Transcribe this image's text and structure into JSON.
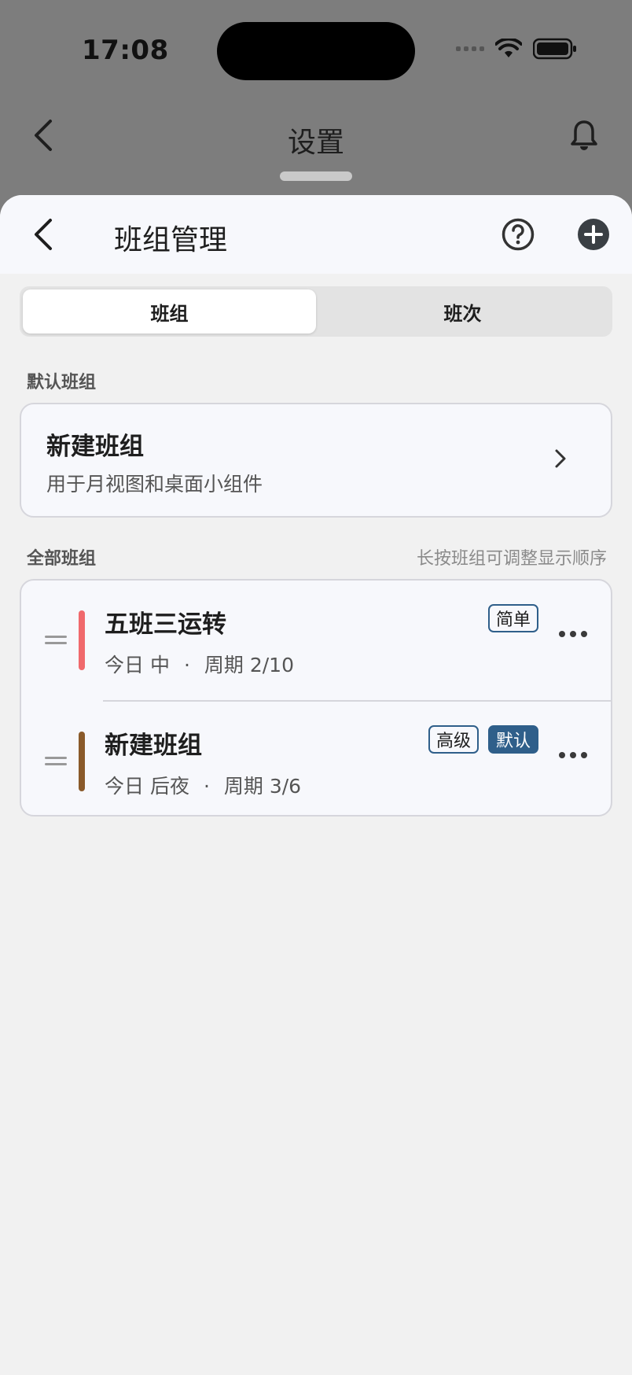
{
  "status_bar": {
    "time": "17:08"
  },
  "background_nav": {
    "title": "设置"
  },
  "sheet_nav": {
    "title": "班组管理"
  },
  "tabs": [
    {
      "label": "班组",
      "active": true
    },
    {
      "label": "班次",
      "active": false
    }
  ],
  "default_section": {
    "label": "默认班组",
    "card": {
      "title": "新建班组",
      "subtitle": "用于月视图和桌面小组件"
    }
  },
  "all_section": {
    "label": "全部班组",
    "hint": "长按班组可调整显示顺序",
    "items": [
      {
        "title": "五班三运转",
        "today": "今日 中",
        "separator": "·",
        "cycle": "周期 2/10",
        "color": "#f0696c",
        "badges": [
          {
            "label": "简单",
            "style": "outline"
          }
        ]
      },
      {
        "title": "新建班组",
        "today": "今日 后夜",
        "separator": "·",
        "cycle": "周期 3/6",
        "color": "#8a5a2a",
        "badges": [
          {
            "label": "高级",
            "style": "outline"
          },
          {
            "label": "默认",
            "style": "filled"
          }
        ]
      }
    ]
  },
  "colors": {
    "accent": "#2f5f8a",
    "sheet_bg": "#f1f1f1",
    "card_bg": "#f7f8fc"
  }
}
